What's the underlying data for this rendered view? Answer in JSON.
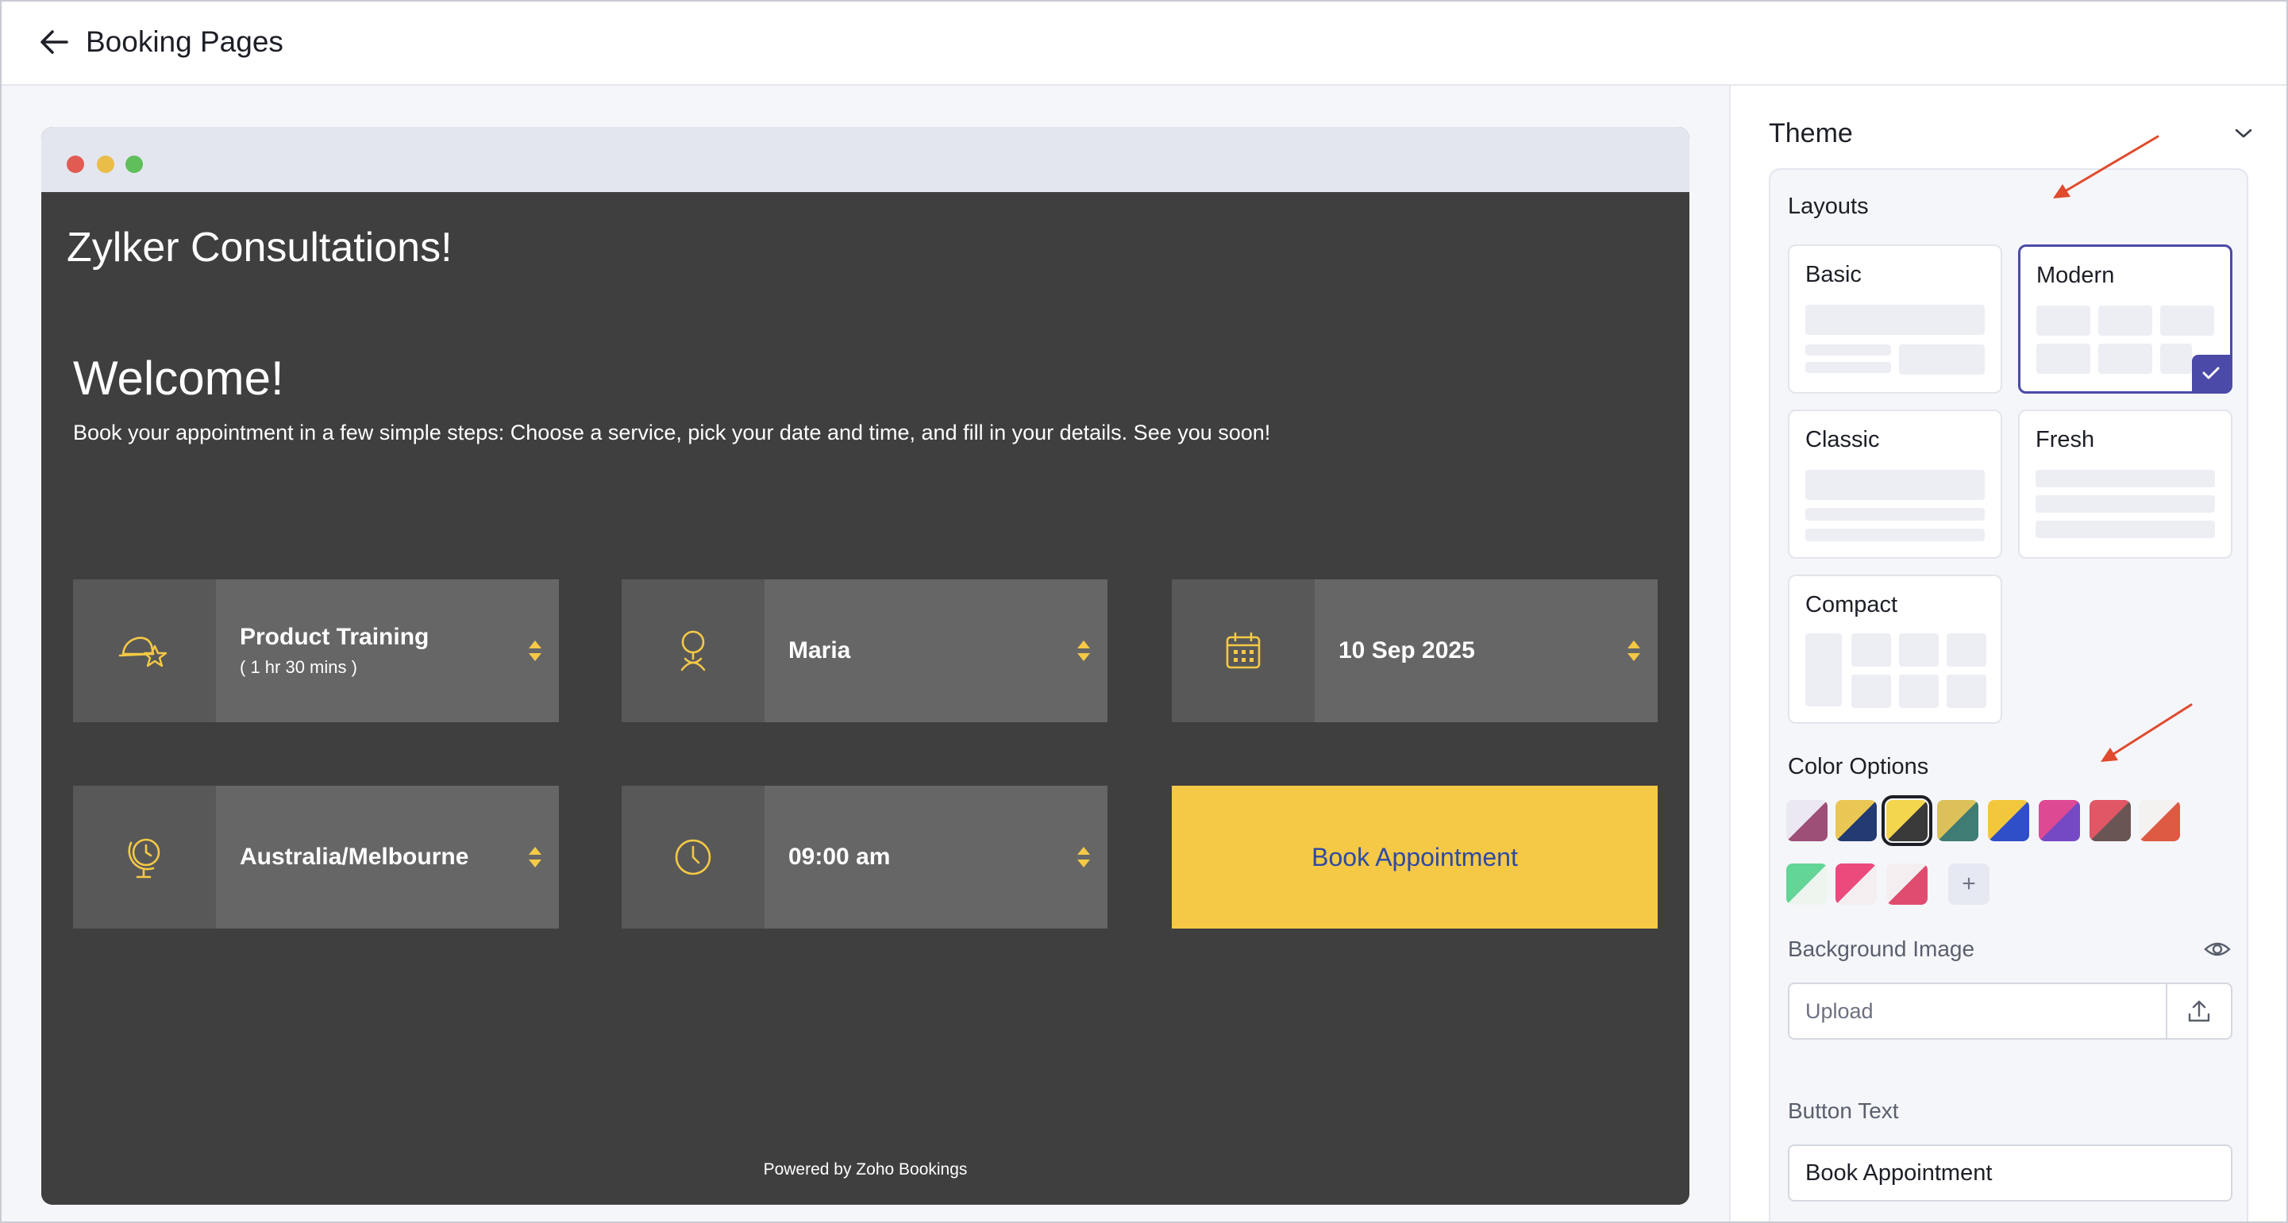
{
  "header": {
    "back_icon": "arrow-left-icon",
    "title": "Booking Pages"
  },
  "preview": {
    "site_title": "Zylker Consultations!",
    "welcome_title": "Welcome!",
    "welcome_text": "Book your appointment in a few simple steps: Choose a service, pick your date and time, and fill in your details. See you soon!",
    "tiles": [
      {
        "icon": "cap-icon",
        "label": "Product Training",
        "sub": "( 1 hr 30 mins )"
      },
      {
        "icon": "person-icon",
        "label": "Maria",
        "sub": ""
      },
      {
        "icon": "calendar-icon",
        "label": "10 Sep 2025",
        "sub": ""
      },
      {
        "icon": "globe-clock-icon",
        "label": "Australia/Melbourne",
        "sub": ""
      },
      {
        "icon": "clock-icon",
        "label": "09:00 am",
        "sub": ""
      }
    ],
    "book_button": "Book Appointment",
    "powered_by": "Powered by Zoho Bookings",
    "accent_color": "#f5c945",
    "background_color": "#3f3f3f"
  },
  "panel": {
    "theme_title": "Theme",
    "layouts_title": "Layouts",
    "layouts": [
      {
        "name": "Basic",
        "selected": false
      },
      {
        "name": "Modern",
        "selected": true
      },
      {
        "name": "Classic",
        "selected": false
      },
      {
        "name": "Fresh",
        "selected": false
      },
      {
        "name": "Compact",
        "selected": false
      }
    ],
    "color_options_title": "Color Options",
    "color_swatches": [
      {
        "a": "#ece8f1",
        "b": "#9e4f78",
        "selected": false
      },
      {
        "a": "#eac655",
        "b": "#243a72",
        "selected": false
      },
      {
        "a": "#f3d54e",
        "b": "#3a3a3a",
        "selected": true
      },
      {
        "a": "#dcc15a",
        "b": "#3f7c73",
        "selected": false
      },
      {
        "a": "#f2c73c",
        "b": "#2e4fc8",
        "selected": false
      },
      {
        "a": "#dd4a93",
        "b": "#7649c4",
        "selected": false
      },
      {
        "a": "#e15766",
        "b": "#6a5555",
        "selected": false
      },
      {
        "a": "#f4f2f0",
        "b": "#df5a43",
        "selected": false
      },
      {
        "a": "#63d597",
        "b": "#eef5ef",
        "selected": false
      },
      {
        "a": "#ea4a7c",
        "b": "#f5eef1",
        "selected": false
      },
      {
        "a": "#f5eef1",
        "b": "#e04c6f",
        "selected": false
      }
    ],
    "add_color_icon": "plus-icon",
    "background_image_label": "Background Image",
    "background_image_placeholder": "Upload",
    "upload_icon": "upload-icon",
    "eye_icon": "eye-icon",
    "button_text_label": "Button Text",
    "button_text_value": "Book Appointment"
  }
}
